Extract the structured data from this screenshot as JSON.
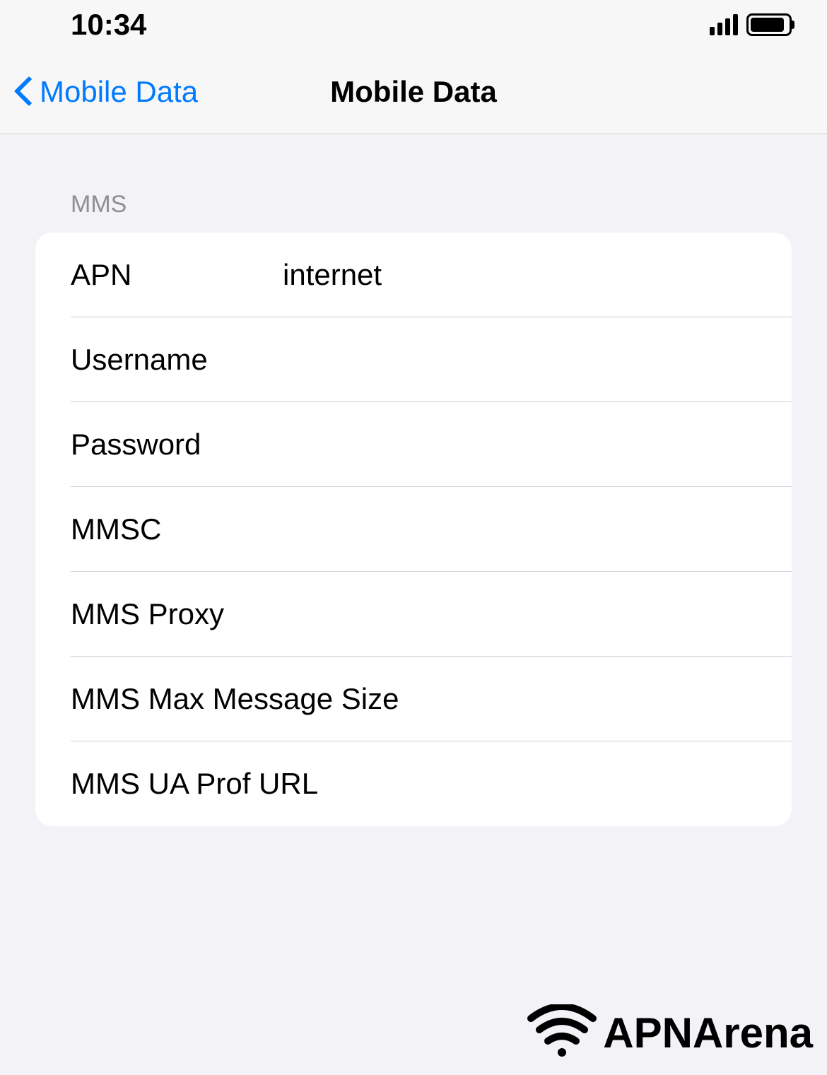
{
  "status": {
    "time": "10:34"
  },
  "nav": {
    "back_label": "Mobile Data",
    "title": "Mobile Data"
  },
  "section": {
    "header": "MMS",
    "rows": {
      "apn": {
        "label": "APN",
        "value": "internet"
      },
      "username": {
        "label": "Username",
        "value": ""
      },
      "password": {
        "label": "Password",
        "value": ""
      },
      "mmsc": {
        "label": "MMSC",
        "value": ""
      },
      "mms_proxy": {
        "label": "MMS Proxy",
        "value": ""
      },
      "mms_max_size": {
        "label": "MMS Max Message Size",
        "value": ""
      },
      "mms_ua_prof": {
        "label": "MMS UA Prof URL",
        "value": ""
      }
    }
  },
  "watermark": {
    "text": "APNArena"
  }
}
